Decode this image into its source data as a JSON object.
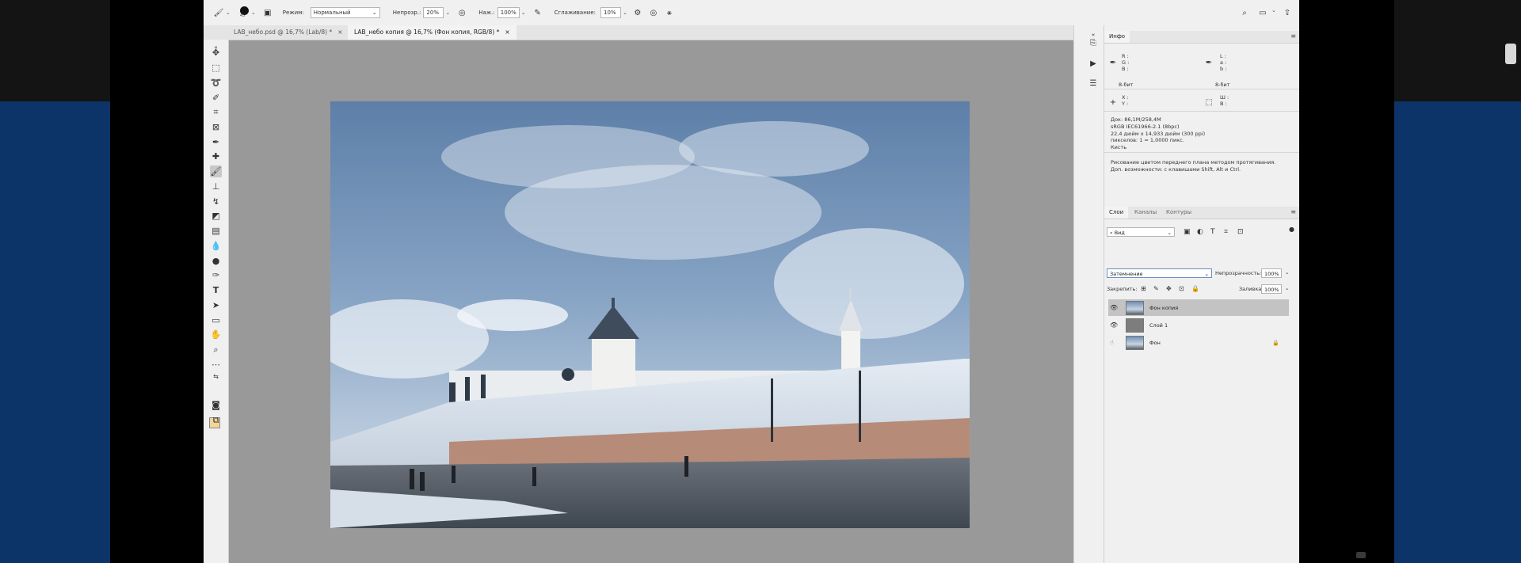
{
  "options_bar": {
    "brush_size": "45",
    "mode_label": "Режим:",
    "mode_value": "Нормальный",
    "opacity_label": "Непрозр.:",
    "opacity_value": "20%",
    "flow_label": "Наж.:",
    "flow_value": "100%",
    "smoothing_label": "Сглаживание:",
    "smoothing_value": "10%"
  },
  "tabs": [
    {
      "label": "LAB_небо.psd @ 16,7% (Lab/8) *",
      "close": "×"
    },
    {
      "label": "LAB_небо копия @ 16,7% (Фон копия, RGB/8) *",
      "close": "×"
    }
  ],
  "info_panel": {
    "tab": "Инфо",
    "rgb": {
      "r": "R :",
      "g": "G :",
      "b": "B :"
    },
    "lab": {
      "l": "L :",
      "a": "a :",
      "b": "b :"
    },
    "bits_left": "8-бит",
    "bits_right": "8-бит",
    "xy": {
      "x": "X :",
      "y": "Y :"
    },
    "wh": {
      "w": "Ш :",
      "h": "В :"
    },
    "doc": "Док: 86,1M/258,4M",
    "profile": "sRGB IEC61966-2.1 (8bpc)",
    "size": "22,4 дюйм x 14,933 дюйм (300 ppi)",
    "pixels": "пикселов: 1 = 1,0000 пикс.",
    "tool": "Кисть",
    "hint1": "Рисование цветом переднего плана методом протягивания.",
    "hint2": "Доп. возможности: с клавишами Shift, Alt и Ctrl."
  },
  "layers_panel": {
    "tabs": [
      "Слои",
      "Каналы",
      "Контуры"
    ],
    "filter": "Вид",
    "blend_mode": "Затемнение",
    "opacity_label": "Непрозрачность:",
    "opacity_value": "100%",
    "lock_label": "Закрепить:",
    "fill_label": "Заливка:",
    "fill_value": "100%",
    "layers": [
      {
        "name": "Фон копия",
        "selected": true,
        "visible": true
      },
      {
        "name": "Слой 1",
        "selected": false,
        "visible": true
      },
      {
        "name": "Фон",
        "selected": false,
        "visible": false,
        "locked": true
      }
    ]
  },
  "colors": {
    "foreground": "#f2d59b",
    "background": "#ffffff",
    "canvas": "#999999",
    "page_bg": "#0c3468"
  }
}
